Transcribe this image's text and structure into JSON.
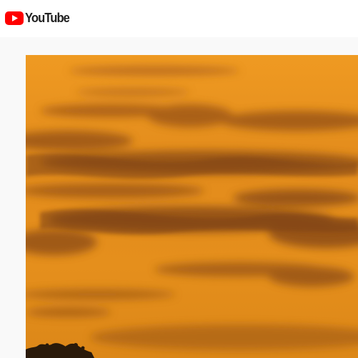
{
  "header": {
    "logo_text": "YouTube",
    "logo_icon": "youtube-play-icon",
    "brand_color": "#ff0000"
  },
  "video": {
    "scene": "sunset-sky",
    "sky_color": "#e8901a"
  }
}
